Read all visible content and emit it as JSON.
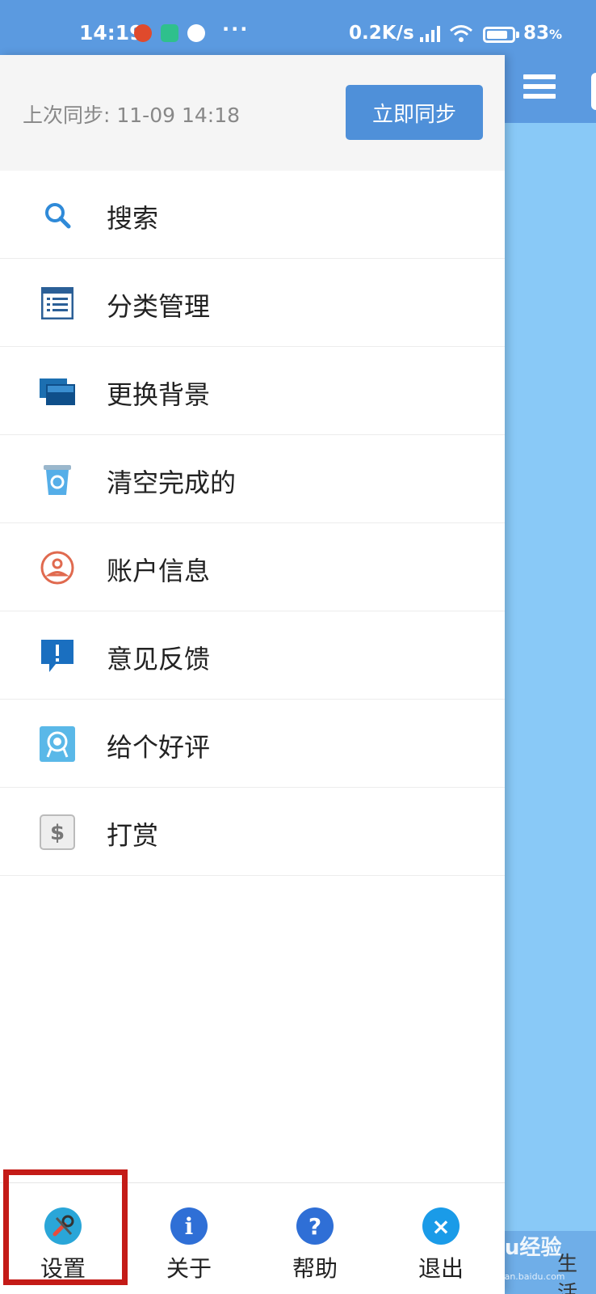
{
  "status_bar": {
    "time": "14:19",
    "dots": "···",
    "speed": "0.2K/s",
    "battery_level": 0.83,
    "battery_pct": "83",
    "battery_unit": "%"
  },
  "sync": {
    "last_sync_text": "上次同步: 11-09 14:18",
    "sync_button": "立即同步"
  },
  "menu": {
    "items": [
      {
        "label": "搜索",
        "icon": "search-icon"
      },
      {
        "label": "分类管理",
        "icon": "list-icon"
      },
      {
        "label": "更换背景",
        "icon": "background-icon"
      },
      {
        "label": "清空完成的",
        "icon": "recycle-bin-icon"
      },
      {
        "label": "账户信息",
        "icon": "account-icon"
      },
      {
        "label": "意见反馈",
        "icon": "feedback-icon"
      },
      {
        "label": "给个好评",
        "icon": "rating-icon"
      },
      {
        "label": "打赏",
        "icon": "dollar-icon"
      }
    ]
  },
  "bottom_bar": {
    "items": [
      {
        "label": "设置",
        "icon": "settings-icon"
      },
      {
        "label": "关于",
        "icon": "info-icon"
      },
      {
        "label": "帮助",
        "icon": "help-icon"
      },
      {
        "label": "退出",
        "icon": "exit-icon"
      }
    ]
  },
  "background_app": {
    "bottom_text": "生活"
  },
  "watermark": {
    "text": "Baidu经验",
    "sub": "jingyan.baidu.com"
  },
  "colors": {
    "status_bar": "#5b9ae0",
    "accent": "#4f90d9",
    "highlight": "#c41b17",
    "background_app": "#89c9f7"
  }
}
